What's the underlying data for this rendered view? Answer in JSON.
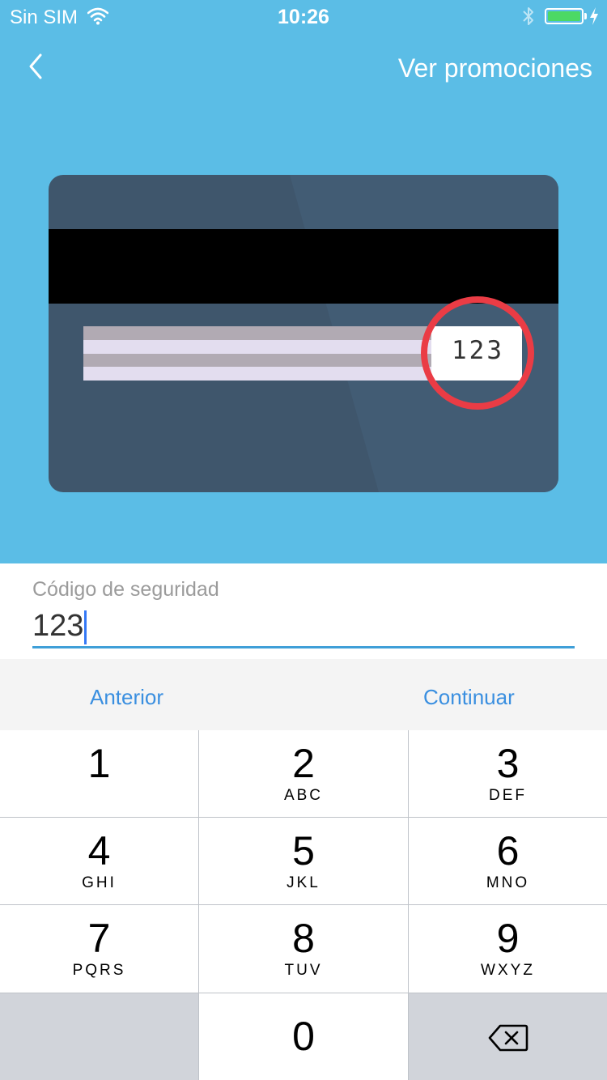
{
  "status_bar": {
    "carrier": "Sin SIM",
    "time": "10:26",
    "battery_level": 1.0,
    "battery_color": "#4cd964"
  },
  "header": {
    "background": "#5bbde6",
    "back_icon": "chevron-left-icon",
    "promo_link": "Ver promociones"
  },
  "card_illustration": {
    "cvv": "123",
    "highlight_color": "#ea3c45",
    "card_color": "#3f566c"
  },
  "form": {
    "field_label": "Código de seguridad",
    "field_value": "123",
    "underline_color": "#3f9fd8"
  },
  "accessory_bar": {
    "prev_label": "Anterior",
    "next_label": "Continuar",
    "accent": "#3a8fe0"
  },
  "keypad": {
    "keys": [
      {
        "digit": "1",
        "letters": ""
      },
      {
        "digit": "2",
        "letters": "ABC"
      },
      {
        "digit": "3",
        "letters": "DEF"
      },
      {
        "digit": "4",
        "letters": "GHI"
      },
      {
        "digit": "5",
        "letters": "JKL"
      },
      {
        "digit": "6",
        "letters": "MNO"
      },
      {
        "digit": "7",
        "letters": "PQRS"
      },
      {
        "digit": "8",
        "letters": "TUV"
      },
      {
        "digit": "9",
        "letters": "WXYZ"
      },
      {
        "digit": "0",
        "letters": ""
      }
    ],
    "delete_icon": "backspace-icon"
  }
}
